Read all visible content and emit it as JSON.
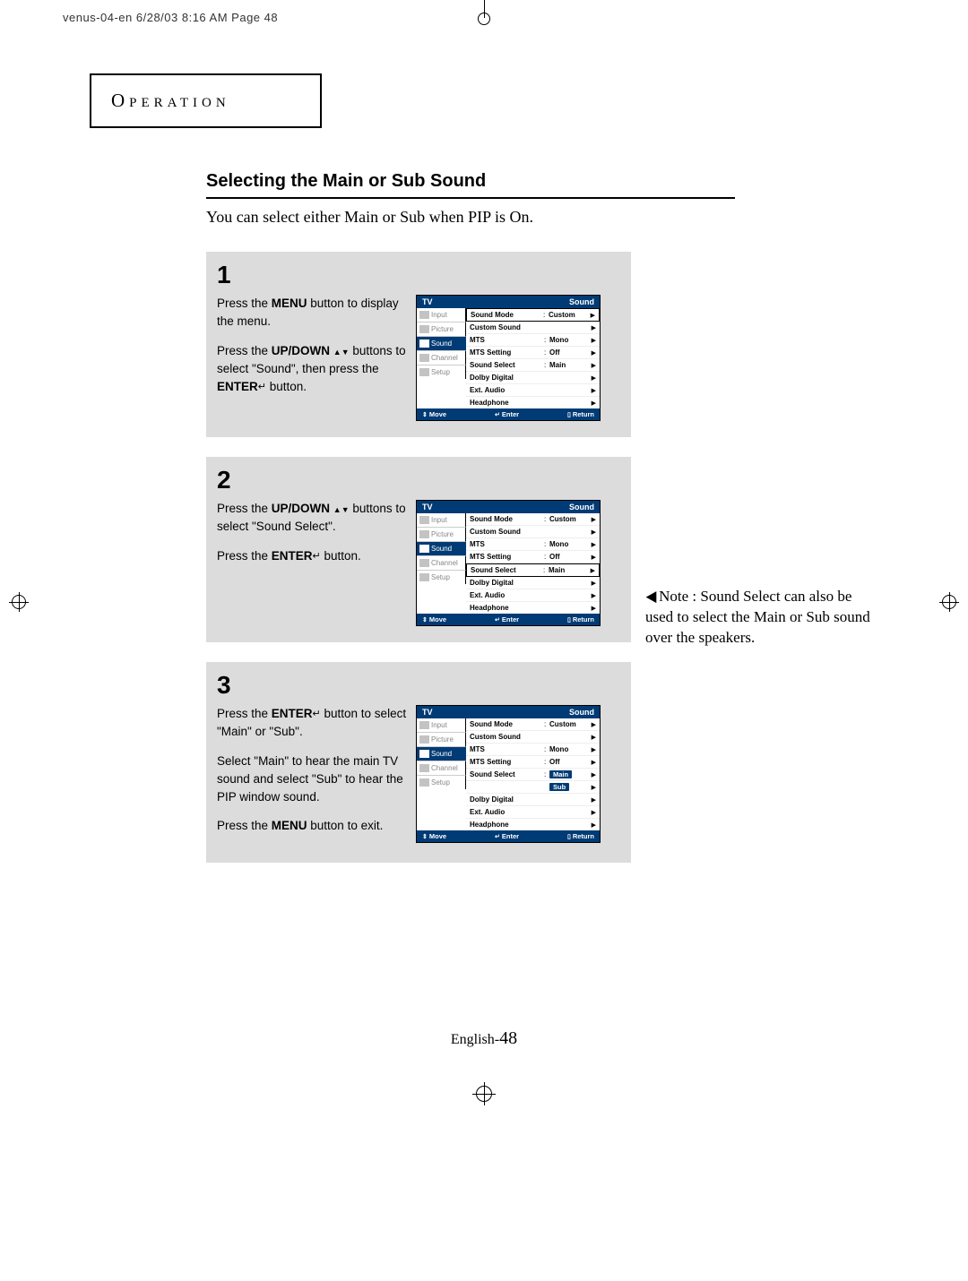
{
  "print_header": "venus-04-en  6/28/03 8:16 AM  Page 48",
  "op_title": "Operation",
  "heading": "Selecting the Main or Sub Sound",
  "intro": "You can select either Main or Sub when PIP is On.",
  "steps": [
    {
      "num": "1",
      "paragraphs": [
        {
          "segments": [
            {
              "t": "Press the "
            },
            {
              "t": "MENU",
              "b": true
            },
            {
              "t": " button to display the menu."
            }
          ]
        },
        {
          "segments": [
            {
              "t": "Press the "
            },
            {
              "t": "UP/DOWN",
              "b": true
            },
            {
              "t": " "
            },
            {
              "tri_up": true
            },
            {
              "tri_down": true
            },
            {
              "t": " buttons to select \"Sound\", then press the "
            },
            {
              "t": "ENTER",
              "b": true
            },
            {
              "enter_icon": true
            },
            {
              "t": " button."
            }
          ]
        }
      ],
      "menu": {
        "highlight_idx": 0,
        "dropdown": false
      }
    },
    {
      "num": "2",
      "paragraphs": [
        {
          "segments": [
            {
              "t": "Press the "
            },
            {
              "t": "UP/DOWN",
              "b": true
            },
            {
              "t": " "
            },
            {
              "tri_up": true
            },
            {
              "tri_down": true
            },
            {
              "t": " buttons to select \"Sound Select\"."
            }
          ]
        },
        {
          "segments": [
            {
              "t": "Press the "
            },
            {
              "t": "ENTER",
              "b": true
            },
            {
              "enter_icon": true
            },
            {
              "t": " button."
            }
          ]
        }
      ],
      "menu": {
        "highlight_idx": 4,
        "dropdown": false
      }
    },
    {
      "num": "3",
      "paragraphs": [
        {
          "segments": [
            {
              "t": "Press the "
            },
            {
              "t": "ENTER",
              "b": true
            },
            {
              "enter_icon": true
            },
            {
              "t": " button to select \"Main\" or \"Sub\"."
            }
          ]
        },
        {
          "segments": [
            {
              "t": "Select \"Main\" to hear the main TV sound and select \"Sub\" to hear the PIP window sound."
            }
          ]
        },
        {
          "segments": [
            {
              "t": "Press the "
            },
            {
              "t": "MENU",
              "b": true
            },
            {
              "t": " button to exit."
            }
          ]
        }
      ],
      "menu": {
        "highlight_idx": 4,
        "dropdown": true
      }
    }
  ],
  "tv_menu_common": {
    "title_left": "TV",
    "title_right": "Sound",
    "nav": [
      "Input",
      "Picture",
      "Sound",
      "Channel",
      "Setup"
    ],
    "nav_sel": 2,
    "rows": [
      {
        "label": "Sound Mode",
        "val": "Custom",
        "colon": true
      },
      {
        "label": "Custom Sound",
        "val": ""
      },
      {
        "label": "MTS",
        "val": "Mono",
        "colon": true
      },
      {
        "label": "MTS Setting",
        "val": "Off",
        "colon": true
      },
      {
        "label": "Sound Select",
        "val": "Main",
        "colon": true
      },
      {
        "label": "Dolby Digital",
        "val": ""
      },
      {
        "label": "Ext. Audio",
        "val": ""
      },
      {
        "label": "Headphone",
        "val": ""
      }
    ],
    "dropdown_options": [
      "Main",
      "Sub"
    ],
    "footer": {
      "move": "Move",
      "enter": "Enter",
      "ret": "Return"
    }
  },
  "note": {
    "label": "Note :",
    "text": "Sound Select can also be used to select the Main or Sub sound over the speakers."
  },
  "footer_page": {
    "prefix": "English-",
    "num": "48"
  }
}
